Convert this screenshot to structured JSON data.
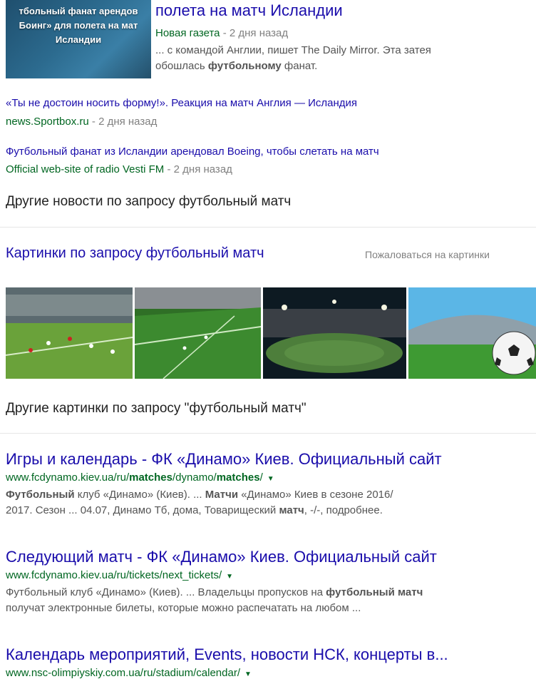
{
  "news": {
    "thumb_caption": [
      "тбольный фанат арендов",
      "Боинг» для полета на мат",
      "Исландии"
    ],
    "main": {
      "title": "полета на матч Исландии",
      "source": "Новая газета",
      "time": " - 2 дня назад",
      "snippet_a": "... с командой Англии, пишет The Daily Mirror. Эта затея",
      "snippet_b1": "обошлась ",
      "snippet_b2": "футбольному",
      "snippet_b3": " фанат."
    },
    "items": [
      {
        "title": "«Ты не достоин носить форму!». Реакция на матч Англия — Исландия",
        "source": "news.Sportbox.ru",
        "time": " - 2 дня назад"
      },
      {
        "title": "Футбольный фанат из Исландии арендовал Boeing, чтобы слетать на матч",
        "source": "Official web-site of radio Vesti FM",
        "time": " - 2 дня назад"
      }
    ],
    "more": "Другие новости по запросу футбольный матч"
  },
  "images": {
    "title": "Картинки по запросу футбольный матч",
    "report": "Пожаловаться на картинки",
    "tiles": [
      "football-match-photo-1",
      "football-pitch-photo-2",
      "stadium-night-photo-3",
      "stadium-ball-photo-4"
    ],
    "more": "Другие картинки по запросу \"футбольный матч\""
  },
  "results": [
    {
      "title": "Игры и календарь - ФК «Динамо» Киев. Официальный сайт",
      "url_parts": [
        "www.fcdynamo.kiev.ua/ru/",
        "matches",
        "/dynamo/",
        "matches",
        "/"
      ],
      "line1": [
        "Футбольный",
        " клуб «Динамо» (Киев). ... ",
        "Матчи",
        " «Динамо» Киев в сезоне 2016/"
      ],
      "line2": [
        "2017. Сезон ... 04.07, Динамо Тб, дома, Товарищеский ",
        "матч",
        ", -/-, подробнее."
      ]
    },
    {
      "title": "Следующий матч - ФК «Динамо» Киев. Официальный сайт",
      "url_parts": [
        "www.fcdynamo.kiev.ua/ru/tickets/next_tickets/"
      ],
      "line1": [
        "Футбольный клуб «Динамо» (Киев). ... Владельцы пропусков на ",
        "футбольный матч"
      ],
      "line2": [
        "получат электронные билеты, которые можно распечатать на любом ..."
      ]
    },
    {
      "title": "Календарь мероприятий, Events, новости НСК, концерты в...",
      "url_parts": [
        "www.nsc-olimpiyskiy.com.ua/ru/stadium/calendar/"
      ]
    }
  ],
  "colors": {
    "link": "#1a0dab",
    "url": "#006621",
    "text": "#545454",
    "meta": "#808080"
  }
}
